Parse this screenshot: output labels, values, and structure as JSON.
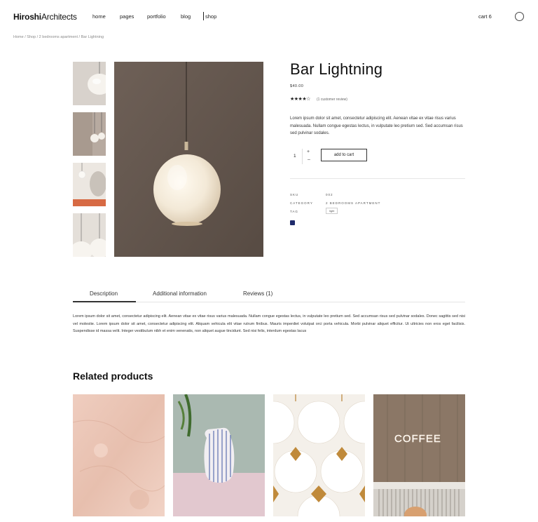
{
  "header": {
    "logo_bold": "Hiroshi",
    "logo_rest": "Architects",
    "nav": [
      "home",
      "pages",
      "portfolio",
      "blog",
      "shop"
    ],
    "cart_label": "cart 6"
  },
  "breadcrumb": "Home / Shop / 2 bedrooms apartment / Bar Lightning",
  "product": {
    "title": "Bar Lightning",
    "price": "$40.00",
    "rating": 4,
    "rating_max": 5,
    "stars_text": "★★★★☆",
    "reviews_link": "(1 customer review)",
    "description": "Lorem ipsum dolor sit amet, consectetur adipiscing elit. Aenean vitae ex vitae risus varius malesuada. Nullam congue egestas lectus, in vulputate leo pretium sed. Sed accumsan risus sed pulvinar sodales.",
    "quantity": "1",
    "qty_plus": "+",
    "qty_minus": "–",
    "add_to_cart": "add to cart",
    "meta": {
      "sku_label": "SKU",
      "sku_value": "002",
      "category_label": "CATEGORY",
      "category_value": "2 BEDROOMS APARTMENT",
      "tag_label": "TAG",
      "tag_value": "light"
    }
  },
  "tabs": {
    "items": [
      "Description",
      "Additional information",
      "Reviews (1)"
    ],
    "active": "Description",
    "content": "Lorem ipsum dolor sit amet, consectetur adipiscing elit. Aenean vitae ex vitae risus varius malesuada. Nullam congue egestas lectus, in vulputate leo pretium sed. Sed accumsan risus sed pulvinar sodales. Donec sagittis sed nisi vel molestie. Lorem ipsum dolor sit amet, consectetur adipiscing elit. Aliquam vehicula elit vitae rutrum finibus. Mauris imperdiet volutpat orci porta vehicula. Morbi pulvinar aliquet efficitur. Ut ultricies non eros eget facilisis. Suspendisse id massa velit. Integer vestibulum nibh et enim venenatis, non aliquet augue tincidunt. Sed nisi felis, interdum egestas lacus"
  },
  "related": {
    "title": "Related products",
    "sign_text": "COFFEE"
  },
  "colors": {
    "text": "#1b1b1b",
    "lamp_bg": "#5f5249",
    "accent_dark": "#111111"
  }
}
